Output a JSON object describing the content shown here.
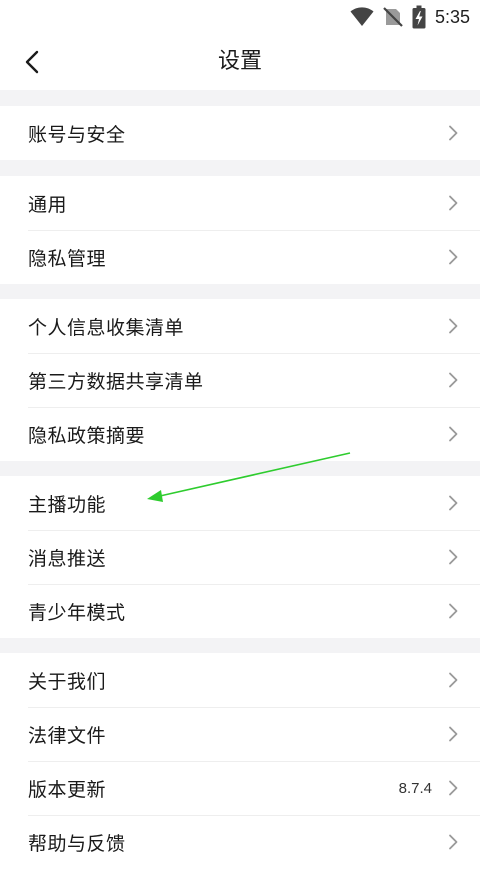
{
  "status_bar": {
    "time": "5:35",
    "icons": [
      "wifi-icon",
      "no-sim-icon",
      "battery-charging-icon"
    ]
  },
  "header": {
    "title": "设置",
    "back_icon": "chevron-left-icon"
  },
  "groups": [
    {
      "items": [
        {
          "label": "账号与安全"
        }
      ]
    },
    {
      "items": [
        {
          "label": "通用"
        },
        {
          "label": "隐私管理"
        }
      ]
    },
    {
      "items": [
        {
          "label": "个人信息收集清单"
        },
        {
          "label": "第三方数据共享清单"
        },
        {
          "label": "隐私政策摘要"
        }
      ]
    },
    {
      "items": [
        {
          "label": "主播功能"
        },
        {
          "label": "消息推送"
        },
        {
          "label": "青少年模式"
        }
      ]
    },
    {
      "items": [
        {
          "label": "关于我们"
        },
        {
          "label": "法律文件"
        },
        {
          "label": "版本更新",
          "value": "8.7.4"
        },
        {
          "label": "帮助与反馈"
        }
      ]
    }
  ],
  "colors": {
    "background": "#f3f3f5",
    "surface": "#ffffff",
    "chevron": "#9a9a9a",
    "annotation_arrow": "#2ecc2e"
  }
}
